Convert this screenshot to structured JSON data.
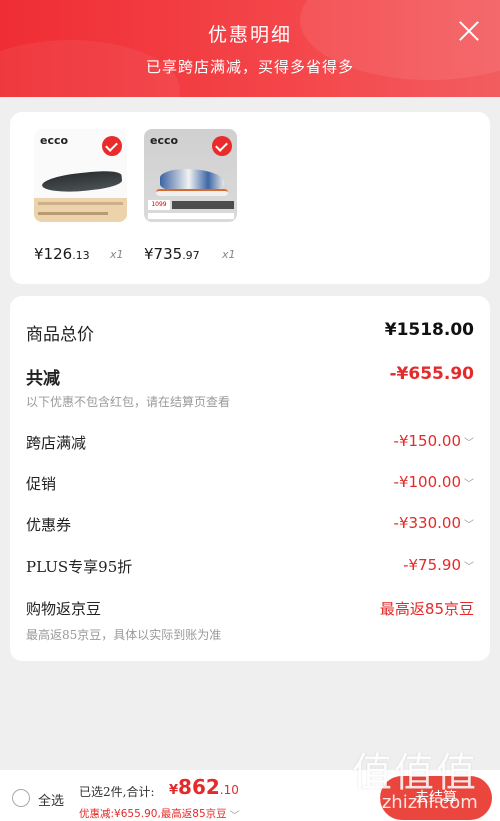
{
  "header": {
    "title": "优惠明细",
    "subtitle": "已享跨店满减，买得多省得多"
  },
  "products": [
    {
      "brand": "ecco",
      "price_main": "¥126",
      "price_decimal": ".13",
      "qty": "x1",
      "selected": true
    },
    {
      "brand": "ecco",
      "price_main": "¥735",
      "price_decimal": ".97",
      "qty": "x1",
      "selected": true,
      "tag": "1099"
    }
  ],
  "summary": {
    "total_label": "商品总价",
    "total_value": "¥1518.00",
    "discount_label": "共减",
    "discount_value": "-¥655.90",
    "discount_note": "以下优惠不包含红包，请在结算页查看",
    "items": [
      {
        "label": "跨店满减",
        "value": "-¥150.00"
      },
      {
        "label": "促销",
        "value": "-¥100.00"
      },
      {
        "label": "优惠券",
        "value": "-¥330.00"
      },
      {
        "label": "PLUS专享95折",
        "value": "-¥75.90"
      }
    ],
    "jd_bean_label": "购物返京豆",
    "jd_bean_value": "最高返85京豆",
    "jd_bean_note": "最高返85京豆，具体以实际到账为准"
  },
  "bottom_bar": {
    "select_all": "全选",
    "selected_text": "已选2件,合计:",
    "currency": "¥",
    "total_main": "862",
    "total_decimal": ".10",
    "discount_line": "优惠减:¥655.90,最高返85京豆",
    "settle_label": "去结算"
  },
  "watermark": {
    "big": "值值值",
    "url": "zhizhizhi.com"
  },
  "colors": {
    "accent": "#e42a2a",
    "header": "#ef2d34"
  }
}
